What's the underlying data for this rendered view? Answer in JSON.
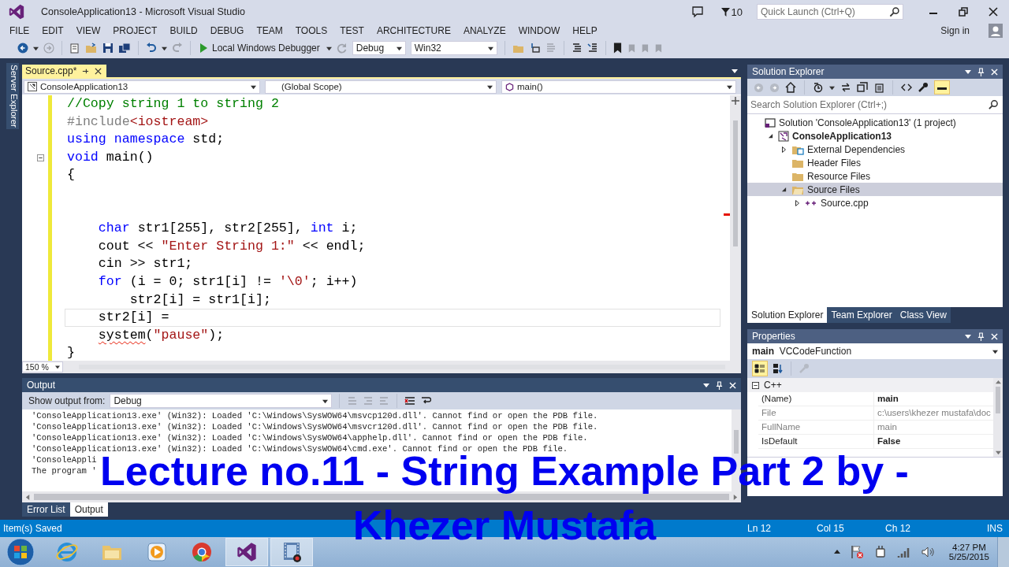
{
  "window": {
    "title": "ConsoleApplication13 - Microsoft Visual Studio",
    "notifications": "10",
    "quick_launch": {
      "placeholder": "Quick Launch (Ctrl+Q)"
    },
    "sign_in": "Sign in"
  },
  "menu": [
    "FILE",
    "EDIT",
    "VIEW",
    "PROJECT",
    "BUILD",
    "DEBUG",
    "TEAM",
    "TOOLS",
    "TEST",
    "ARCHITECTURE",
    "ANALYZE",
    "WINDOW",
    "HELP"
  ],
  "toolbar": {
    "debugger": "Local Windows Debugger",
    "configuration": "Debug",
    "platform": "Win32"
  },
  "side_tab": "Server Explorer",
  "editor": {
    "tab": {
      "label": "Source.cpp*",
      "selected": true
    },
    "project_dropdown": "ConsoleApplication13",
    "scope_dropdown": "(Global Scope)",
    "member_dropdown": "main()",
    "zoom": "150 %",
    "lines": [
      {
        "kind": "code",
        "changed": true,
        "tokens": [
          {
            "kind": "comment",
            "text": "//Copy string 1 to string 2"
          }
        ]
      },
      {
        "kind": "code",
        "changed": true,
        "tokens": [
          {
            "kind": "directive",
            "text": "#include"
          },
          {
            "kind": "include",
            "text": "<iostream>"
          }
        ]
      },
      {
        "kind": "code",
        "changed": true,
        "tokens": [
          {
            "kind": "keyword",
            "text": "using"
          },
          {
            "kind": "keyword",
            "text": " namespace"
          },
          {
            "kind": "plain",
            "text": " std;"
          }
        ]
      },
      {
        "kind": "code",
        "changed": true,
        "fold": true,
        "tokens": [
          {
            "kind": "keyword",
            "text": "void"
          },
          {
            "kind": "plain",
            "text": " main()"
          }
        ]
      },
      {
        "kind": "code",
        "changed": true,
        "tokens": [
          {
            "kind": "plain",
            "text": "{"
          }
        ]
      },
      {
        "kind": "blank",
        "changed": true
      },
      {
        "kind": "blank",
        "changed": true
      },
      {
        "kind": "code",
        "changed": true,
        "tokens": [
          {
            "kind": "keyword",
            "text": "    char"
          },
          {
            "kind": "plain",
            "text": " str1[255], str2[255], "
          },
          {
            "kind": "keyword",
            "text": "int"
          },
          {
            "kind": "plain",
            "text": " i;"
          }
        ]
      },
      {
        "kind": "code",
        "changed": true,
        "tokens": [
          {
            "kind": "plain",
            "text": "    cout << "
          },
          {
            "kind": "string",
            "text": "\"Enter String 1:\""
          },
          {
            "kind": "plain",
            "text": " << endl;"
          }
        ]
      },
      {
        "kind": "code",
        "changed": true,
        "tokens": [
          {
            "kind": "plain",
            "text": "    cin >> str1;"
          }
        ]
      },
      {
        "kind": "code",
        "changed": true,
        "tokens": [
          {
            "kind": "keyword",
            "text": "    for"
          },
          {
            "kind": "plain",
            "text": " (i = 0; str1[i] != "
          },
          {
            "kind": "string",
            "text": "'\\0'"
          },
          {
            "kind": "plain",
            "text": "; i++)"
          }
        ]
      },
      {
        "kind": "code",
        "changed": true,
        "tokens": [
          {
            "kind": "plain",
            "text": "        str2[i] = str1[i];"
          }
        ]
      },
      {
        "kind": "code",
        "changed": true,
        "current": true,
        "tokens": [
          {
            "kind": "plain",
            "text": "    str2[i] ="
          }
        ]
      },
      {
        "kind": "code",
        "changed": true,
        "tokens": [
          {
            "kind": "plain",
            "text": "    system",
            "error": true
          },
          {
            "kind": "plain",
            "text": "("
          },
          {
            "kind": "string",
            "text": "\"pause\""
          },
          {
            "kind": "plain",
            "text": ");"
          }
        ]
      },
      {
        "kind": "code",
        "changed": true,
        "tokens": [
          {
            "kind": "plain",
            "text": "}"
          }
        ]
      }
    ]
  },
  "output": {
    "title": "Output",
    "show_from_label": "Show output from:",
    "source": "Debug",
    "lines": [
      "'ConsoleApplication13.exe' (Win32): Loaded 'C:\\Windows\\SysWOW64\\msvcp120d.dll'. Cannot find or open the PDB file.",
      "'ConsoleApplication13.exe' (Win32): Loaded 'C:\\Windows\\SysWOW64\\msvcr120d.dll'. Cannot find or open the PDB file.",
      "'ConsoleApplication13.exe' (Win32): Loaded 'C:\\Windows\\SysWOW64\\apphelp.dll'. Cannot find or open the PDB file.",
      "'ConsoleApplication13.exe' (Win32): Loaded 'C:\\Windows\\SysWOW64\\cmd.exe'. Cannot find or open the PDB file.",
      "'ConsoleAppli",
      "The program '"
    ],
    "tabs": [
      {
        "label": "Error List",
        "selected": false
      },
      {
        "label": "Output",
        "selected": true
      }
    ]
  },
  "solution_explorer": {
    "title": "Solution Explorer",
    "search": {
      "placeholder": "Search Solution Explorer (Ctrl+;)"
    },
    "tree": [
      {
        "kind": "solution",
        "label": "Solution 'ConsoleApplication13' (1 project)",
        "selected": false,
        "children": [
          {
            "kind": "project",
            "label": "ConsoleApplication13",
            "expanded": true,
            "selected": false,
            "children": [
              {
                "kind": "dependencies",
                "label": "External Dependencies",
                "expanded": false,
                "selected": false
              },
              {
                "kind": "folder",
                "label": "Header Files",
                "selected": false
              },
              {
                "kind": "folder",
                "label": "Resource Files",
                "selected": false
              },
              {
                "kind": "open-folder",
                "label": "Source Files",
                "expanded": true,
                "selected": true,
                "children": [
                  {
                    "kind": "cpp",
                    "label": "Source.cpp",
                    "expanded": false,
                    "selected": false
                  }
                ]
              }
            ]
          }
        ]
      }
    ],
    "tabs": [
      {
        "label": "Solution Explorer",
        "selected": true
      },
      {
        "label": "Team Explorer",
        "selected": false
      },
      {
        "label": "Class View",
        "selected": false
      }
    ]
  },
  "properties": {
    "title": "Properties",
    "object_name": "main",
    "object_type": "VCCodeFunction",
    "category": "C++",
    "rows": [
      {
        "name": "(Name)",
        "value": "main",
        "bold": true,
        "disabled": false
      },
      {
        "name": "File",
        "value": "c:\\users\\khezer mustafa\\doc",
        "bold": false,
        "disabled": true
      },
      {
        "name": "FullName",
        "value": "main",
        "bold": false,
        "disabled": true
      },
      {
        "name": "IsDefault",
        "value": "False",
        "bold": true,
        "disabled": false
      }
    ]
  },
  "status_bar": {
    "message": "Item(s) Saved",
    "line": "Ln 12",
    "column": "Col 15",
    "char": "Ch 12",
    "mode": "INS"
  },
  "taskbar": {
    "apps": [
      {
        "kind": "browser-e",
        "active": false
      },
      {
        "kind": "folder",
        "active": false
      },
      {
        "kind": "player",
        "active": false
      },
      {
        "kind": "chrome",
        "active": false
      },
      {
        "kind": "vs",
        "active": true
      },
      {
        "kind": "film",
        "active": true
      }
    ],
    "time": "4:27 PM",
    "date": "5/25/2015"
  },
  "caption": [
    "Lecture no.11 - String Example Part 2 by -",
    "Khezer Mustafa"
  ]
}
